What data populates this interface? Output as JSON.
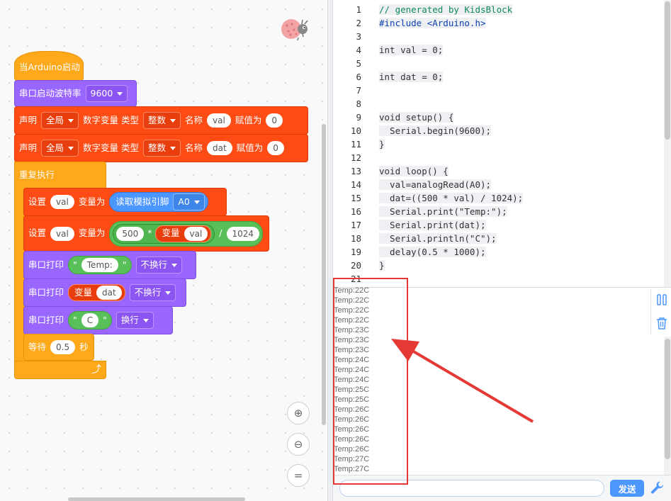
{
  "blocks": {
    "hat": "当Arduino启动",
    "serial_begin": {
      "label": "串口启动波特率",
      "baud": "9600"
    },
    "declare_val": {
      "label": "声明",
      "scope": "全局",
      "kind": "数字变量 类型",
      "type": "整数",
      "name_label": "名称",
      "name": "val",
      "assign_label": "赋值为",
      "value": "0"
    },
    "declare_dat": {
      "label": "声明",
      "scope": "全局",
      "kind": "数字变量 类型",
      "type": "整数",
      "name_label": "名称",
      "name": "dat",
      "assign_label": "赋值为",
      "value": "0"
    },
    "forever": "重复执行",
    "set_val": {
      "label": "设置",
      "var": "val",
      "as": "变量为",
      "read": "读取模拟引脚",
      "pin": "A0"
    },
    "set_dat": {
      "label": "设置",
      "var": "val",
      "as": "变量为",
      "a": "500",
      "mul": "*",
      "var_label": "变量",
      "div": "/",
      "b": "1024"
    },
    "print1": {
      "label": "串口打印",
      "q1": "\"",
      "text": "Temp:",
      "q2": "\"",
      "mode": "不换行"
    },
    "print2": {
      "label": "串口打印",
      "var_label": "变量",
      "var": "dat",
      "mode": "不换行"
    },
    "print3": {
      "label": "串口打印",
      "q1": "\"",
      "text": "C",
      "q2": "\"",
      "mode": "换行"
    },
    "wait": {
      "label": "等待",
      "value": "0.5",
      "unit": "秒"
    }
  },
  "zoom": {
    "in": "⊕",
    "out": "⊖",
    "reset": "="
  },
  "code": {
    "line_numbers": [
      "1",
      "2",
      "3",
      "4",
      "5",
      "6",
      "7",
      "8",
      "9",
      "10",
      "11",
      "12",
      "13",
      "14",
      "15",
      "16",
      "17",
      "18",
      "19",
      "20",
      "21"
    ],
    "lines": [
      "// generated by KidsBlock",
      "#include <Arduino.h>",
      "",
      "int val = 0;",
      "",
      "int dat = 0;",
      "",
      "",
      "void setup() {",
      "  Serial.begin(9600);",
      "}",
      "",
      "void loop() {",
      "  val=analogRead(A0);",
      "  dat=((500 * val) / 1024);",
      "  Serial.print(\"Temp:\");",
      "  Serial.print(dat);",
      "  Serial.println(\"C\");",
      "  delay(0.5 * 1000);",
      "}",
      ""
    ]
  },
  "serial_output": [
    "Temp:22C",
    "Temp:22C",
    "Temp:22C",
    "Temp:22C",
    "Temp:23C",
    "Temp:23C",
    "Temp:23C",
    "Temp:24C",
    "Temp:24C",
    "Temp:24C",
    "Temp:25C",
    "Temp:25C",
    "Temp:26C",
    "Temp:26C",
    "Temp:26C",
    "Temp:26C",
    "Temp:26C",
    "Temp:27C",
    "Temp:27C"
  ],
  "send": {
    "placeholder": "",
    "button": "发送"
  },
  "colors": {
    "event": "#ffa819",
    "serial": "#9966ff",
    "variable": "#ff4b14",
    "operator": "#59c059",
    "pin": "#4c97ff",
    "annotation": "#e53935"
  }
}
